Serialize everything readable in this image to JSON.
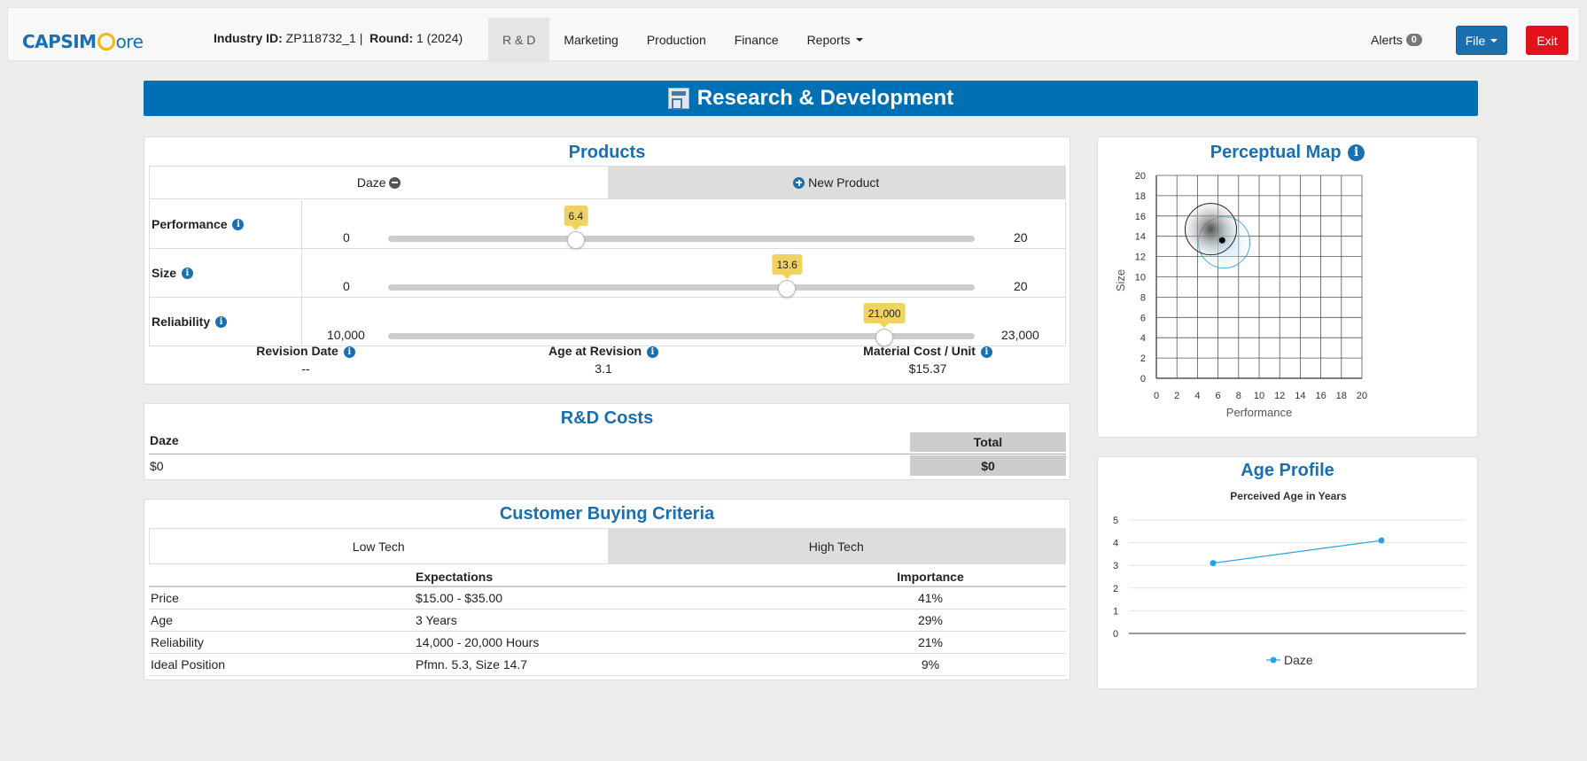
{
  "colors": {
    "brand_blue": "#0070b4",
    "title_blue": "#1a6fb0",
    "exit_red": "#e3111a",
    "tip_yellow": "#f0d263",
    "series_blue": "#2aa3e0"
  },
  "navbar": {
    "logo_capsim": "CAPSIM",
    "logo_core": "ore",
    "industry_label": "Industry ID:",
    "industry_value": "ZP118732_1 |",
    "round_label": "Round:",
    "round_value": "1 (2024)",
    "tabs": [
      {
        "label": "R & D",
        "active": true
      },
      {
        "label": "Marketing"
      },
      {
        "label": "Production"
      },
      {
        "label": "Finance"
      },
      {
        "label": "Reports"
      }
    ],
    "alerts_label": "Alerts",
    "alerts_count": "0",
    "file_label": "File",
    "exit_label": "Exit"
  },
  "header": {
    "title": "Research & Development"
  },
  "products": {
    "title": "Products",
    "tabs": [
      {
        "label": "Daze"
      },
      {
        "label": "New Product"
      }
    ],
    "sliders": [
      {
        "label": "Performance",
        "min": 0,
        "max": 20,
        "value": 6.4,
        "min_label": "0",
        "max_label": "20",
        "tip": "6.4"
      },
      {
        "label": "Size",
        "min": 0,
        "max": 20,
        "value": 13.6,
        "min_label": "0",
        "max_label": "20",
        "tip": "13.6"
      },
      {
        "label": "Reliability",
        "min": 10000,
        "max": 23000,
        "value": 21000,
        "min_label": "10,000",
        "max_label": "23,000",
        "tip": "21,000"
      }
    ],
    "stats": [
      {
        "label": "Revision Date",
        "value": "--"
      },
      {
        "label": "Age at Revision",
        "value": "3.1"
      },
      {
        "label": "Material Cost / Unit",
        "value": "$15.37"
      }
    ]
  },
  "costs": {
    "title": "R&D Costs",
    "product_label": "Daze",
    "product_value": "$0",
    "total_label": "Total",
    "total_value": "$0"
  },
  "criteria": {
    "title": "Customer Buying Criteria",
    "tabs": [
      {
        "label": "Low Tech"
      },
      {
        "label": "High Tech"
      }
    ],
    "headers": {
      "name": "",
      "expectations": "Expectations",
      "importance": "Importance"
    },
    "rows": [
      {
        "name": "Price",
        "expectations": "$15.00 - $35.00",
        "importance": "41%"
      },
      {
        "name": "Age",
        "expectations": "3 Years",
        "importance": "29%"
      },
      {
        "name": "Reliability",
        "expectations": "14,000 - 20,000 Hours",
        "importance": "21%"
      },
      {
        "name": "Ideal Position",
        "expectations": "Pfmn. 5.3, Size 14.7",
        "importance": "9%"
      }
    ]
  },
  "perceptual_map": {
    "title": "Perceptual Map",
    "chart_data": {
      "type": "scatter",
      "xlabel": "Performance",
      "ylabel": "Size",
      "xlim": [
        0,
        20
      ],
      "ylim": [
        0,
        20
      ],
      "ticks": [
        0,
        2,
        4,
        6,
        8,
        10,
        12,
        14,
        16,
        18,
        20
      ],
      "grid": true,
      "segment_circles": [
        {
          "x": 5.3,
          "y": 14.7,
          "radius": 2.5,
          "style": "dark"
        },
        {
          "x": 6.6,
          "y": 13.4,
          "radius": 2.5,
          "style": "light-blue"
        }
      ],
      "points": [
        {
          "x": 6.4,
          "y": 13.6
        }
      ]
    }
  },
  "age_profile": {
    "title": "Age Profile",
    "chart_data": {
      "type": "line",
      "title": "Perceived Age in Years",
      "ylim": [
        0,
        5
      ],
      "yticks": [
        0,
        1,
        2,
        3,
        4,
        5
      ],
      "series": [
        {
          "name": "Daze",
          "x": [
            1,
            2
          ],
          "values": [
            3.1,
            4.1
          ]
        }
      ],
      "grid": true,
      "legend": "bottom"
    }
  }
}
